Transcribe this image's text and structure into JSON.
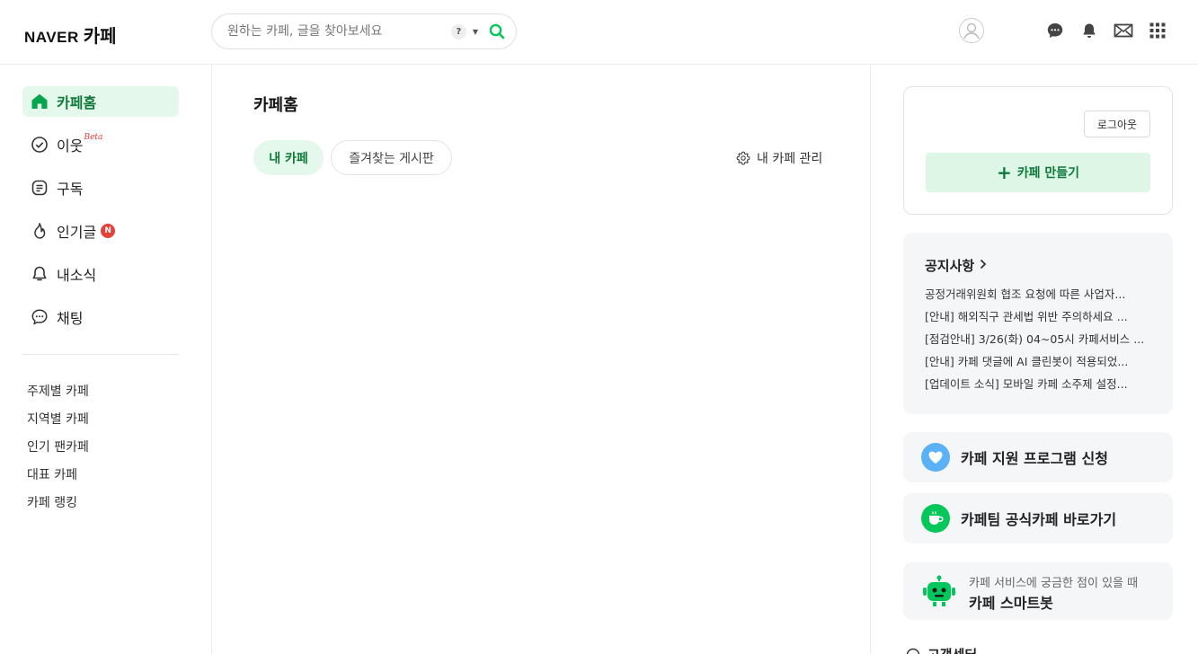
{
  "header": {
    "logo_brand": "NAVER",
    "logo_service": "카페",
    "search_placeholder": "원하는 카페, 글을 찾아보세요",
    "search_help": "?"
  },
  "sidebar": {
    "items": [
      {
        "label": "카페홈",
        "icon": "home-icon",
        "active": true
      },
      {
        "label": "이웃",
        "icon": "check-circle-icon",
        "tag": "Beta"
      },
      {
        "label": "구독",
        "icon": "document-icon"
      },
      {
        "label": "인기글",
        "icon": "flame-icon",
        "badge": "N"
      },
      {
        "label": "내소식",
        "icon": "bell-icon"
      },
      {
        "label": "채팅",
        "icon": "chat-icon"
      }
    ],
    "links": [
      "주제별 카페",
      "지역별 카페",
      "인기 팬카페",
      "대표 카페",
      "카페 랭킹"
    ]
  },
  "main": {
    "title": "카페홈",
    "tabs": [
      {
        "label": "내 카페",
        "active": true
      },
      {
        "label": "즐겨찾는 게시판",
        "active": false
      }
    ],
    "manage_label": "내 카페 관리"
  },
  "right": {
    "logout_label": "로그아웃",
    "create_label": "카페 만들기",
    "notice": {
      "title": "공지사항",
      "items": [
        "공정거래위원회 협조 요청에 따른 사업자...",
        "[안내] 해외직구 관세법 위반 주의하세요 ...",
        "[점검안내] 3/26(화) 04~05시 카페서비스 ...",
        "[안내] 카페 댓글에 AI 클린봇이 적용되었...",
        "[업데이트 소식] 모바일 카페 소주제 설정..."
      ]
    },
    "support_label": "카페 지원 프로그램 신청",
    "official_label": "카페팀 공식카페 바로가기",
    "bot_sub": "카페 서비스에 궁금한 점이 있을 때",
    "bot_title": "카페 스마트봇",
    "cs_label": "고객센터"
  },
  "colors": {
    "accent_green": "#03c75a",
    "active_bg": "#e5f8ec",
    "active_text": "#0f7a3a",
    "badge_red": "#e5413b",
    "heart_blue": "#5ab1f6"
  }
}
